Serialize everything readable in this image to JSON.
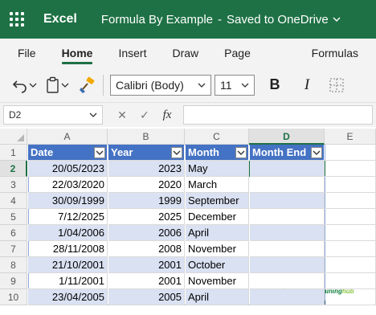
{
  "titlebar": {
    "app": "Excel",
    "document": "Formula By Example",
    "separator": "-",
    "status": "Saved to OneDrive"
  },
  "tabs": [
    "File",
    "Home",
    "Insert",
    "Draw",
    "Page Layout",
    "Formulas"
  ],
  "toolbar": {
    "font": "Calibri (Body)",
    "size": "11",
    "bold": "B",
    "italic": "I"
  },
  "formula_bar": {
    "name_box": "D2",
    "cancel": "✕",
    "enter": "✓",
    "fx": "fx",
    "value": ""
  },
  "sheet": {
    "columns": [
      "A",
      "B",
      "C",
      "D",
      "E"
    ],
    "rows": [
      "1",
      "2",
      "3",
      "4",
      "5",
      "6",
      "7",
      "8",
      "9",
      "10"
    ],
    "headers": [
      "Date",
      "Year",
      "Month",
      "Month End"
    ],
    "data": [
      [
        "20/05/2023",
        "2023",
        "May",
        ""
      ],
      [
        "22/03/2020",
        "2020",
        "March",
        ""
      ],
      [
        "30/09/1999",
        "1999",
        "September",
        ""
      ],
      [
        "7/12/2025",
        "2025",
        "December",
        ""
      ],
      [
        "1/04/2006",
        "2006",
        "April",
        ""
      ],
      [
        "28/11/2008",
        "2008",
        "November",
        ""
      ],
      [
        "21/10/2001",
        "2001",
        "October",
        ""
      ],
      [
        "1/11/2001",
        "2001",
        "November",
        ""
      ],
      [
        "23/04/2005",
        "2005",
        "April",
        ""
      ]
    ],
    "selected_cell": "D2"
  },
  "watermark": {
    "part1": "myOnlineTraining",
    "part2": "hub"
  },
  "colors": {
    "excel_green": "#1e7145",
    "table_header": "#4472c4",
    "table_band": "#d9e1f2"
  }
}
